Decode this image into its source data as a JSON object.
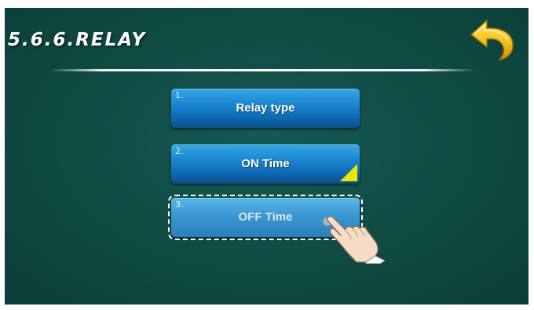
{
  "header": {
    "title": "5.6.6.RELAY"
  },
  "back_button": {
    "icon": "back-arrow-icon",
    "color": "#f2c21a"
  },
  "menu": {
    "items": [
      {
        "number": "1.",
        "label": "Relay type",
        "state": "normal"
      },
      {
        "number": "2.",
        "label": "ON Time",
        "state": "has-corner-marker"
      },
      {
        "number": "3.",
        "label": "OFF Time",
        "state": "selected"
      }
    ]
  },
  "icons": {
    "pointer": "hand-pointer-icon"
  },
  "colors": {
    "background": "#0f4a43",
    "button": "#1a86cf",
    "accent": "#e9e800"
  }
}
